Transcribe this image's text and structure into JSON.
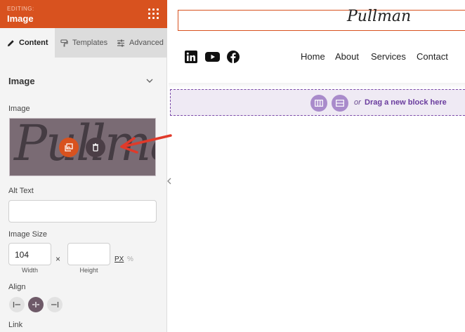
{
  "sidebar": {
    "editing_label": "EDITING:",
    "title": "Image",
    "tabs": [
      {
        "label": "Content",
        "icon": "pencil-icon",
        "active": true
      },
      {
        "label": "Templates",
        "icon": "paint-roller-icon",
        "active": false
      },
      {
        "label": "Advanced",
        "icon": "sliders-icon",
        "active": false
      }
    ],
    "section_title": "Image",
    "image_label": "Image",
    "image_preview_text": "Pullman",
    "alt_text_label": "Alt Text",
    "alt_text_value": "",
    "image_size_label": "Image Size",
    "width_value": "104",
    "width_caption": "Width",
    "height_value": "",
    "height_caption": "Height",
    "times_symbol": "×",
    "unit_px": "PX",
    "unit_percent": "%",
    "align_label": "Align",
    "align_selected": "center",
    "link_label": "Link"
  },
  "canvas": {
    "brand": "Pullman",
    "social_icons": [
      "linkedin-icon",
      "youtube-icon",
      "facebook-icon"
    ],
    "nav": [
      "Home",
      "About",
      "Services",
      "Contact"
    ],
    "drop_zone": {
      "or_text": "or",
      "drag_text": "Drag a new block here"
    }
  },
  "colors": {
    "accent": "#d8521f",
    "purple": "#7b4aa8",
    "annotation_arrow": "#e03a2a"
  }
}
